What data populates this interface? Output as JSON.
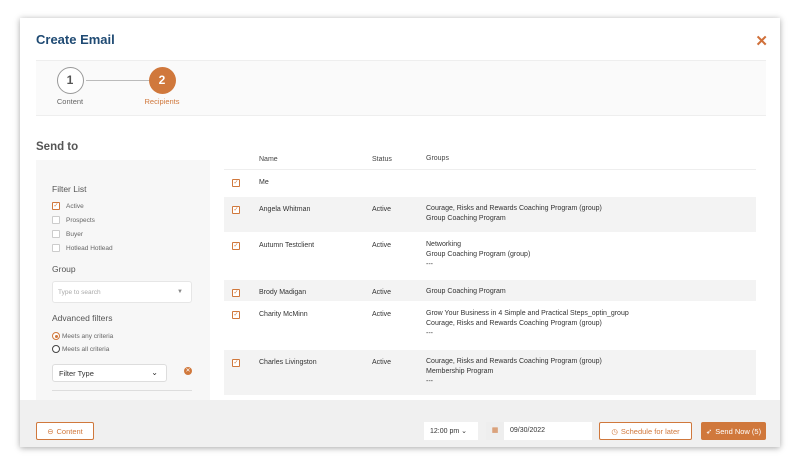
{
  "header": {
    "title": "Create Email",
    "close": "✕"
  },
  "stepper": [
    {
      "num": "1",
      "label": "Content"
    },
    {
      "num": "2",
      "label": "Recipients"
    }
  ],
  "send_to": "Send to",
  "sidebar": {
    "filter_list": "Filter List",
    "filters": [
      {
        "label": "Active",
        "checked": true
      },
      {
        "label": "Prospects",
        "checked": false
      },
      {
        "label": "Buyer",
        "checked": false
      },
      {
        "label": "Hotlead Hotlead",
        "checked": false
      }
    ],
    "group_label": "Group",
    "group_placeholder": "Type to search",
    "advanced": "Advanced filters",
    "radio": [
      {
        "label": "Meets any criteria",
        "selected": true
      },
      {
        "label": "Meets all criteria",
        "selected": false
      }
    ],
    "filter_type": "Filter Type"
  },
  "table": {
    "headers": {
      "name": "Name",
      "status": "Status",
      "groups": "Groups"
    },
    "rows": [
      {
        "name": "Me",
        "status": "",
        "groups": []
      },
      {
        "name": "Angela Whitman",
        "status": "Active",
        "groups": [
          "Courage, Risks and Rewards Coaching Program (group)",
          "Group Coaching Program"
        ]
      },
      {
        "name": "Autumn Testclient",
        "status": "Active",
        "groups": [
          "Networking",
          "Group Coaching Program (group)",
          "---"
        ]
      },
      {
        "name": "Brody Madigan",
        "status": "Active",
        "groups": [
          "Group Coaching Program"
        ]
      },
      {
        "name": "Charity McMinn",
        "status": "Active",
        "groups": [
          "Grow Your Business in 4 Simple and Practical Steps_optin_group",
          "Courage, Risks and Rewards Coaching Program (group)",
          "---"
        ]
      },
      {
        "name": "Charles Livingston",
        "status": "Active",
        "groups": [
          "Courage, Risks and Rewards Coaching Program (group)",
          "Membership Program",
          "---"
        ]
      }
    ]
  },
  "footer": {
    "back": "Content",
    "time": "12:00 pm",
    "date": "09/30/2022",
    "schedule": "Schedule for later",
    "send": "Send Now (5)"
  },
  "colors": {
    "accent": "#d0783c",
    "title": "#1f4a73"
  }
}
